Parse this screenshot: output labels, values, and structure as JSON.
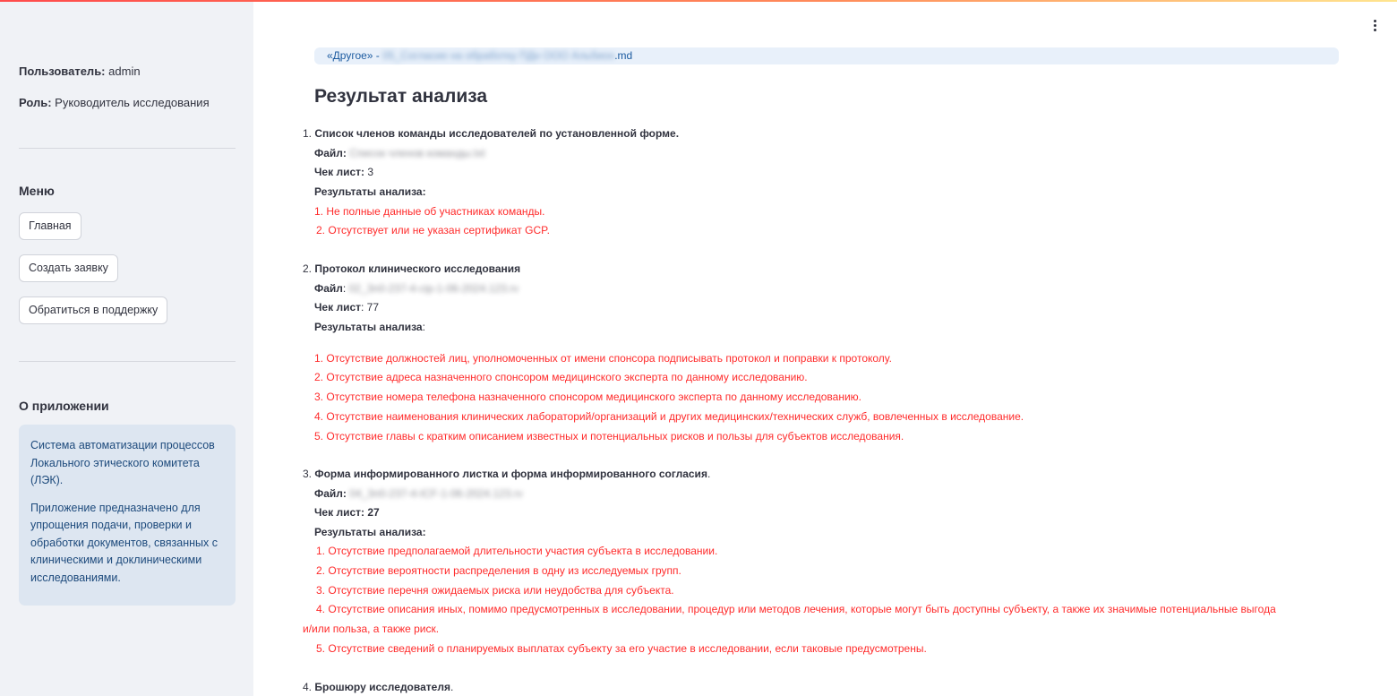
{
  "sidebar": {
    "user_label": "Пользователь:",
    "user_value": "admin",
    "role_label": "Роль:",
    "role_value": "Руководитель исследования",
    "menu_heading": "Меню",
    "buttons": [
      "Главная",
      "Создать заявку",
      "Обратиться в поддержку"
    ],
    "about_heading": "О приложении",
    "about_p1": "Система автоматизации процессов Локального этического комитета (ЛЭК).",
    "about_p2": "Приложение предназначено для упрощения подачи, проверки и обработки документов, связанных с клиническими и доклиническими исследованиями."
  },
  "main": {
    "file_prefix": "«Другое» - ",
    "file_name_hidden": "05_Согласие на обработку ПДн ООО Альбион",
    "file_ext": ".md",
    "title": "Результат анализа",
    "file_label": "Файл",
    "checklist_label": "Чек лист",
    "results_label": "Результаты анализа",
    "sections": [
      {
        "num": "1.",
        "title": "Список членов команды исследователей по установленной форме.",
        "file_hidden": "Список членов команды.txt",
        "checklist": "3",
        "issues": [
          "1. Не полные данные об участниках команды.",
          "2. Отсутствует или не указан сертификат GCP."
        ]
      },
      {
        "num": "2.",
        "title": "Протокол клинического исследования",
        "file_hidden": "02_3n0-237-4-cip-1-06-2024.123.rv",
        "checklist": "77",
        "issues": [
          "1. Отсутствие должностей лиц, уполномоченных от имени спонсора подписывать протокол и поправки к протоколу.",
          "2. Отсутствие адреса назначенного спонсором медицинского эксперта по данному исследованию.",
          "3. Отсутствие номера телефона назначенного спонсором медицинского эксперта по данному исследованию.",
          "4. Отсутствие наименования клинических лабораторий/организаций и других медицинских/технических служб, вовлеченных в исследование.",
          "5. Отсутствие главы с кратким описанием известных и потенциальных рисков и пользы для субъектов исследования."
        ]
      },
      {
        "num": "3.",
        "title": "Форма информированного листка и форма информированного согласия",
        "file_hidden": "04_3n0-237-4-ICF-1-06-2024.123.rv",
        "checklist": "27",
        "issues": [
          "1. Отсутствие предполагаемой длительности участия субъекта в исследовании.",
          "2. Отсутствие вероятности распределения в одну из исследуемых групп.",
          "3. Отсутствие перечня ожидаемых риска или неудобства для субъекта.",
          "4. Отсутствие описания иных, помимо предусмотренных в исследовании, процедур или методов лечения, которые могут быть доступны субъекту, а также их значимые потенциальные выгода",
          "и/или польза, а также риск.",
          "5. Отсутствие сведений о планируемых выплатах субъекту за его участие в исследовании, если таковые предусмотрены."
        ]
      },
      {
        "num": "4.",
        "title": "Брошюру исследователя"
      }
    ]
  },
  "colors": {
    "issue": "#ff2b2b",
    "accent": "#1c5ba0",
    "sidebar_bg": "#f0f2f6"
  }
}
